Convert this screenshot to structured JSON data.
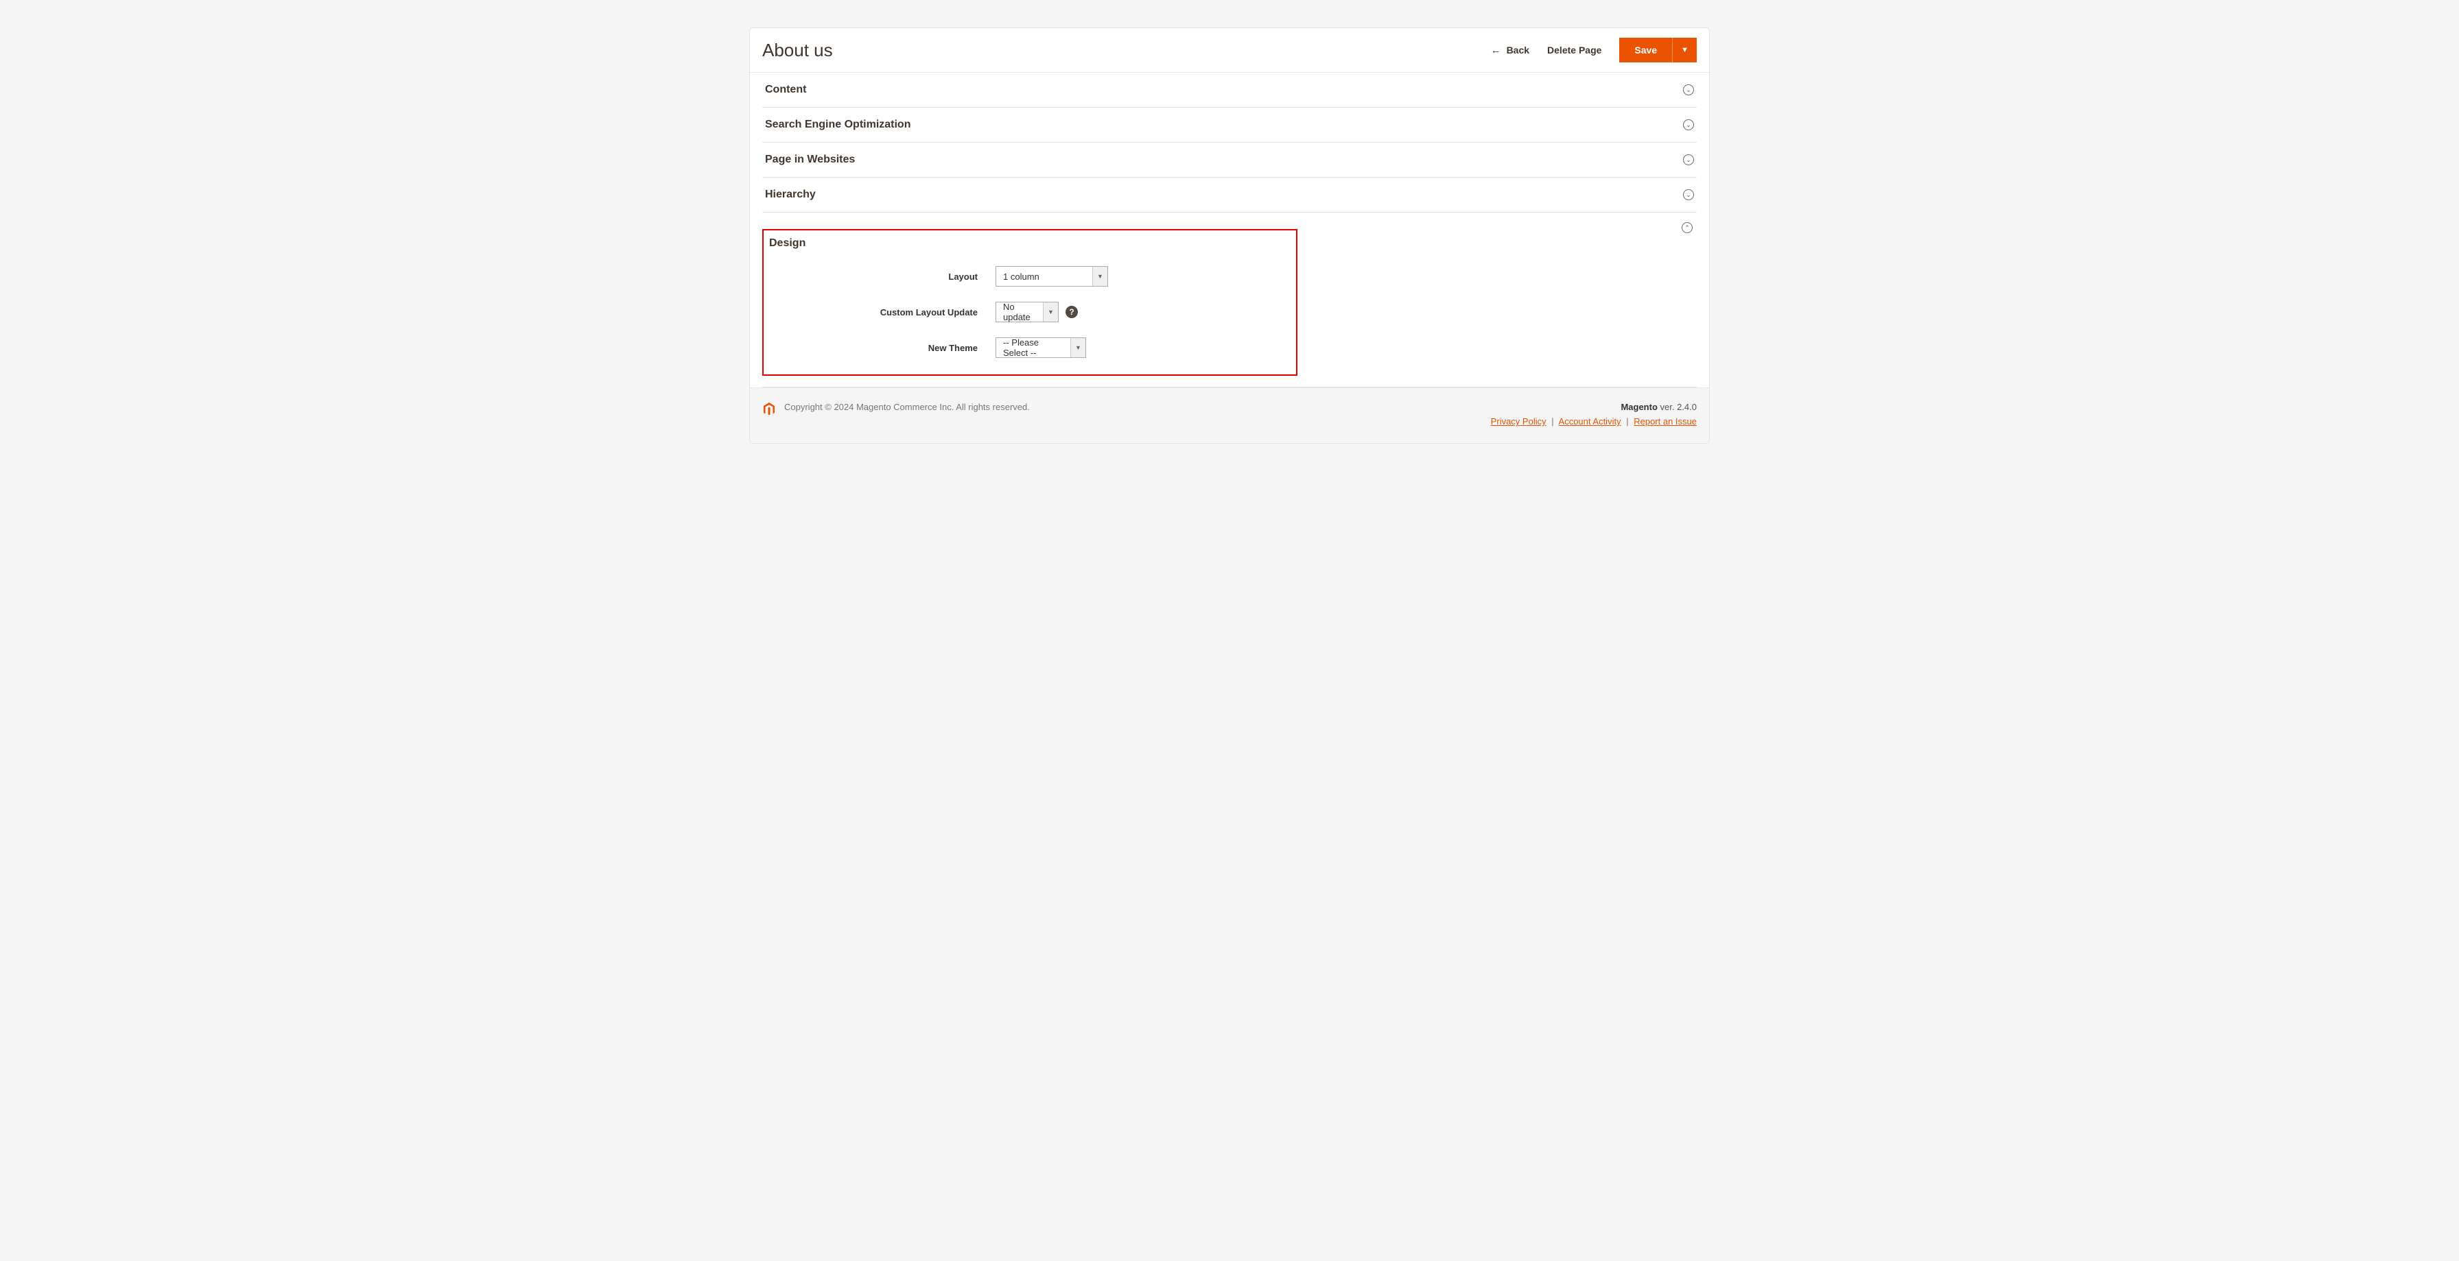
{
  "header": {
    "title": "About us",
    "back_label": "Back",
    "delete_label": "Delete Page",
    "save_label": "Save"
  },
  "sections": {
    "content": "Content",
    "seo": "Search Engine Optimization",
    "websites": "Page in Websites",
    "hierarchy": "Hierarchy",
    "design": "Design"
  },
  "design": {
    "layout_label": "Layout",
    "layout_value": "1 column",
    "custom_layout_label": "Custom Layout Update",
    "custom_layout_value": "No update",
    "theme_label": "New Theme",
    "theme_value": "-- Please Select --"
  },
  "footer": {
    "copyright": "Copyright © 2024 Magento Commerce Inc. All rights reserved.",
    "brand": "Magento",
    "version": " ver. 2.4.0",
    "privacy": "Privacy Policy",
    "activity": "Account Activity",
    "report": "Report an Issue"
  }
}
